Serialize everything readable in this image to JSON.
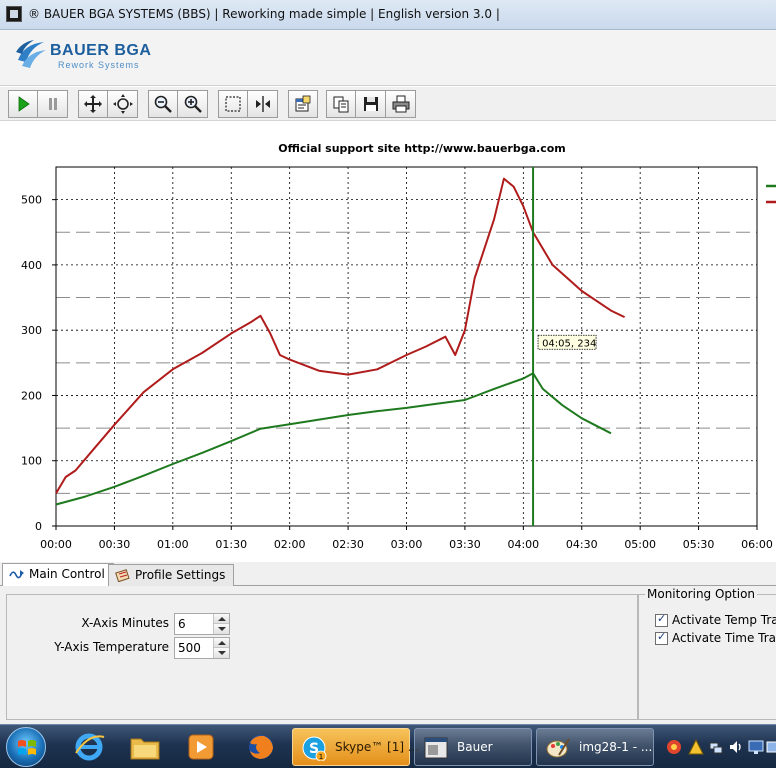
{
  "window": {
    "title": "® BAUER BGA SYSTEMS (BBS) | Reworking made simple | English version 3.0 |"
  },
  "logo": {
    "name": "BAUER BGA",
    "tagline": "Rework Systems"
  },
  "toolbar": {
    "buttons": [
      "play-icon",
      "pause-icon",
      "pan-icon",
      "zoom-fit-icon",
      "zoom-out-icon",
      "zoom-in-icon",
      "select-rect-icon",
      "split-cursor-icon",
      "properties-icon",
      "copy-icon",
      "save-icon",
      "print-icon"
    ]
  },
  "chart": {
    "title": "Official support site http://www.bauerbga.com",
    "cursor_label": "04:05, 234"
  },
  "chart_data": {
    "type": "line",
    "title": "Official support site http://www.bauerbga.com",
    "xlabel": "",
    "ylabel": "",
    "xlim": [
      0,
      360
    ],
    "ylim": [
      0,
      550
    ],
    "x_ticks": [
      "00:00",
      "00:30",
      "01:00",
      "01:30",
      "02:00",
      "02:30",
      "03:00",
      "03:30",
      "04:00",
      "04:30",
      "05:00",
      "05:30",
      "06:00"
    ],
    "y_ticks": [
      0,
      100,
      200,
      300,
      400,
      500
    ],
    "grid": true,
    "dashed_reference_lines": [
      50,
      150,
      250,
      350,
      450
    ],
    "cursor": {
      "x": "04:05",
      "y": 234
    },
    "legend_placement": "top-right",
    "series": [
      {
        "color": "#1f7a1f",
        "points": [
          [
            "00:00",
            33
          ],
          [
            "00:15",
            45
          ],
          [
            "00:30",
            60
          ],
          [
            "00:45",
            77
          ],
          [
            "01:00",
            95
          ],
          [
            "01:15",
            112
          ],
          [
            "01:30",
            130
          ],
          [
            "01:45",
            149
          ],
          [
            "02:00",
            156
          ],
          [
            "02:15",
            163
          ],
          [
            "02:30",
            170
          ],
          [
            "02:45",
            176
          ],
          [
            "03:00",
            181
          ],
          [
            "03:15",
            187
          ],
          [
            "03:30",
            193
          ],
          [
            "03:45",
            210
          ],
          [
            "04:00",
            226
          ],
          [
            "04:05",
            234
          ],
          [
            "04:10",
            210
          ],
          [
            "04:20",
            185
          ],
          [
            "04:30",
            165
          ],
          [
            "04:45",
            142
          ]
        ]
      },
      {
        "color": "#b01c1c",
        "points": [
          [
            "00:00",
            50
          ],
          [
            "00:05",
            75
          ],
          [
            "00:10",
            85
          ],
          [
            "00:20",
            120
          ],
          [
            "00:30",
            155
          ],
          [
            "00:45",
            205
          ],
          [
            "01:00",
            240
          ],
          [
            "01:15",
            265
          ],
          [
            "01:30",
            295
          ],
          [
            "01:40",
            312
          ],
          [
            "01:45",
            322
          ],
          [
            "01:50",
            295
          ],
          [
            "01:55",
            262
          ],
          [
            "02:00",
            255
          ],
          [
            "02:15",
            238
          ],
          [
            "02:30",
            232
          ],
          [
            "02:45",
            240
          ],
          [
            "03:00",
            262
          ],
          [
            "03:10",
            275
          ],
          [
            "03:20",
            290
          ],
          [
            "03:25",
            262
          ],
          [
            "03:30",
            300
          ],
          [
            "03:35",
            380
          ],
          [
            "03:45",
            470
          ],
          [
            "03:50",
            532
          ],
          [
            "03:55",
            520
          ],
          [
            "04:00",
            490
          ],
          [
            "04:05",
            450
          ],
          [
            "04:15",
            400
          ],
          [
            "04:30",
            360
          ],
          [
            "04:45",
            330
          ],
          [
            "04:52",
            320
          ]
        ]
      }
    ]
  },
  "tabs": [
    {
      "label": "Main Control",
      "active": true
    },
    {
      "label": "Profile Settings",
      "active": false
    }
  ],
  "main_control": {
    "x_axis_label": "X-Axis Minutes",
    "x_axis_value": "6",
    "y_axis_label": "Y-Axis Temperature",
    "y_axis_value": "500"
  },
  "monitoring": {
    "legend": "Monitoring Option",
    "temp_label": "Activate Temp Track",
    "time_label": "Activate Time  Track"
  },
  "taskbar": {
    "skype_label": "Skype™ [1] ...",
    "bauer_label": "Bauer",
    "paint_label": "img28-1 - ...",
    "skype_badge": "1"
  }
}
